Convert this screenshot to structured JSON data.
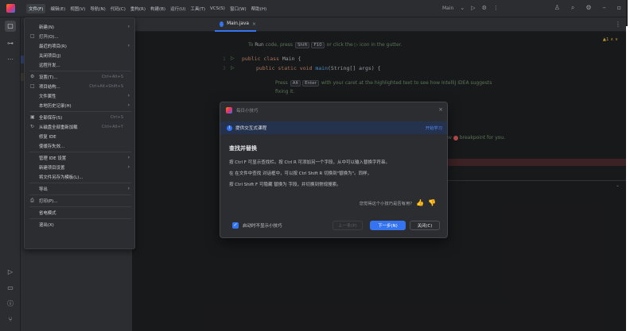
{
  "menubar": {
    "items": [
      "文件(F)",
      "编辑(E)",
      "视图(V)",
      "导航(N)",
      "代码(C)",
      "重构(R)",
      "构建(B)",
      "运行(U)",
      "工具(T)",
      "VCS(S)",
      "窗口(W)",
      "帮助(H)"
    ]
  },
  "runconfig": {
    "name": "Main"
  },
  "file_menu": {
    "items": [
      {
        "label": "新建(N)",
        "shortcut": "",
        "arrow": "›",
        "icon": ""
      },
      {
        "label": "打开(O)...",
        "shortcut": "",
        "arrow": "",
        "icon": "□"
      },
      {
        "label": "最近的项目(R)",
        "shortcut": "",
        "arrow": "›",
        "icon": ""
      },
      {
        "label": "关闭项目(J)",
        "shortcut": "",
        "arrow": "",
        "icon": ""
      },
      {
        "label": "远程开发...",
        "shortcut": "",
        "arrow": "",
        "icon": ""
      },
      {
        "label": "设置(T)...",
        "shortcut": "Ctrl+Alt+S",
        "arrow": "",
        "icon": "⚙"
      },
      {
        "label": "项目结构...",
        "shortcut": "Ctrl+Alt+Shift+S",
        "arrow": "",
        "icon": "□"
      },
      {
        "label": "文件属性",
        "shortcut": "",
        "arrow": "›",
        "icon": ""
      },
      {
        "label": "本地历史记录(H)",
        "shortcut": "",
        "arrow": "›",
        "icon": ""
      },
      {
        "label": "全部保存(S)",
        "shortcut": "Ctrl+S",
        "arrow": "",
        "icon": "▣"
      },
      {
        "label": "从磁盘全部重新加载",
        "shortcut": "Ctrl+Alt+Y",
        "arrow": "",
        "icon": "↻"
      },
      {
        "label": "修复 IDE",
        "shortcut": "",
        "arrow": "",
        "icon": ""
      },
      {
        "label": "使缓存失效...",
        "shortcut": "",
        "arrow": "",
        "icon": ""
      },
      {
        "label": "管理 IDE 设置",
        "shortcut": "",
        "arrow": "›",
        "icon": ""
      },
      {
        "label": "新建项目设置",
        "shortcut": "",
        "arrow": "›",
        "icon": ""
      },
      {
        "label": "将文件另存为模板(L)...",
        "shortcut": "",
        "arrow": "",
        "icon": ""
      },
      {
        "label": "导出",
        "shortcut": "",
        "arrow": "›",
        "icon": ""
      },
      {
        "label": "打印(P)...",
        "shortcut": "",
        "arrow": "",
        "icon": "⎙"
      },
      {
        "label": "省电模式",
        "shortcut": "",
        "arrow": "",
        "icon": ""
      },
      {
        "label": "退出(X)",
        "shortcut": "",
        "arrow": "",
        "icon": ""
      }
    ]
  },
  "editor": {
    "tab": "Main.java",
    "hint1_pre": "To ",
    "hint1_run": "Run",
    "hint1_mid": " code, press ",
    "hint1_k1": "Shift",
    "hint1_k2": "F10",
    "hint1_post": " or click the ▷ icon in the gutter.",
    "line1_kw": "public class ",
    "line1_rest": "Main {",
    "line2_kw": "public static void ",
    "line2_fn": "main",
    "line2_rest": "(String[] args) {",
    "ln1": "1",
    "ln2": "3",
    "hint2_pre": "Press ",
    "hint2_k1": "Alt",
    "hint2_k2": "Enter",
    "hint2_post": " with your caret at the highlighted text to see how IntelliJ IDEA suggests",
    "hint2_line2": "fixing it.",
    "hint3": "breakpoint for you.",
    "hint3_pre": "w",
    "warn": "▲1 ∧ ∨"
  },
  "dialog": {
    "title": "每日小技巧",
    "banner_text": "提供交互式课程",
    "banner_link": "开始学习",
    "heading": "查找并替换",
    "p1": "按 Ctrl F 可显示查找栏。按 Ctrl R 可添加另一个字段，从中可以输入替换字符串。",
    "p2": "在 在文件中查找 对话框中，可以按 Ctrl Shift R 切换到\"替换为\"。同样，",
    "p3": "按 Ctrl Shift F 可隐藏 替换为 字段，并切换到常规搜索。",
    "useful": "您觉得这个小技巧是否有用?",
    "checkbox": "启动时不显示小技巧",
    "btn_prev": "上一条(P)",
    "btn_next": "下一步(N)",
    "btn_close": "关闭(C)"
  }
}
